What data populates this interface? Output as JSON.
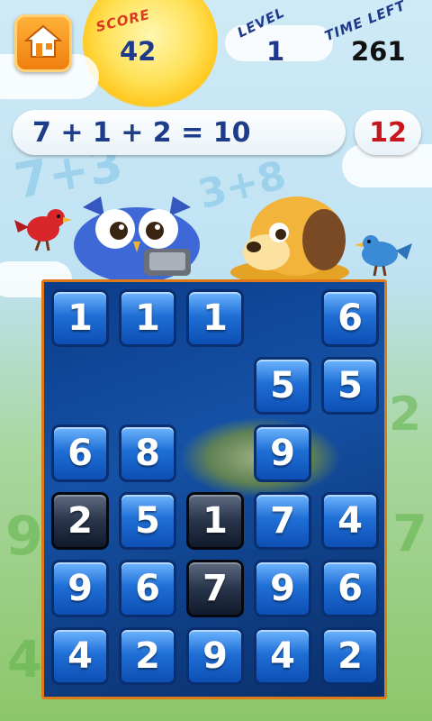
{
  "hud": {
    "score_label": "SCORE",
    "score_value": "42",
    "level_label": "LEVEL",
    "level_value": "1",
    "time_label": "TIME LEFT",
    "time_value": "261"
  },
  "equation": {
    "text": "7 + 1 + 2 = 10",
    "target": "12"
  },
  "board": {
    "rows": 6,
    "cols": 5,
    "cells": [
      [
        "1",
        "1",
        "1",
        null,
        "6"
      ],
      [
        null,
        null,
        null,
        "5",
        "5"
      ],
      [
        "6",
        "8",
        null,
        "9",
        null
      ],
      [
        "2",
        "5",
        "1",
        "7",
        "4"
      ],
      [
        "9",
        "6",
        "7",
        "9",
        "6"
      ],
      [
        "4",
        "2",
        "9",
        "4",
        "2"
      ]
    ],
    "selected": [
      [
        3,
        0
      ],
      [
        3,
        2
      ],
      [
        4,
        2
      ]
    ]
  },
  "icons": {
    "home": "home-icon"
  },
  "colors": {
    "tile": "#1f6fd6",
    "tile_selected": "#28344a",
    "board_border": "#e07a17",
    "target": "#c8161d",
    "score_label": "#d83a22"
  }
}
